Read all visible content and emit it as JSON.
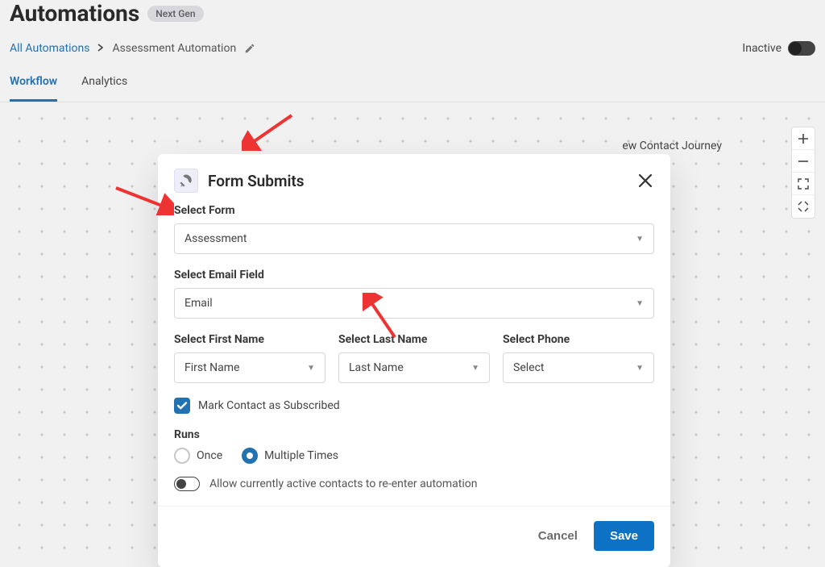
{
  "header": {
    "title": "Automations",
    "badge": "Next Gen"
  },
  "breadcrumb": {
    "root": "All Automations",
    "current": "Assessment Automation"
  },
  "status": {
    "label": "Inactive"
  },
  "tabs": {
    "workflow": "Workflow",
    "analytics": "Analytics"
  },
  "canvas": {
    "journey_label": "ew Contact Journey"
  },
  "modal": {
    "title": "Form Submits",
    "select_form_label": "Select Form",
    "select_form_value": "Assessment",
    "select_email_label": "Select Email Field",
    "select_email_value": "Email",
    "select_first_label": "Select First Name",
    "select_first_value": "First Name",
    "select_last_label": "Select Last Name",
    "select_last_value": "Last Name",
    "select_phone_label": "Select Phone",
    "select_phone_value": "Select",
    "mark_subscribed": "Mark Contact as Subscribed",
    "runs_label": "Runs",
    "runs_once": "Once",
    "runs_multiple": "Multiple Times",
    "allow_reenter": "Allow currently active contacts to re-enter automation",
    "cancel": "Cancel",
    "save": "Save"
  }
}
